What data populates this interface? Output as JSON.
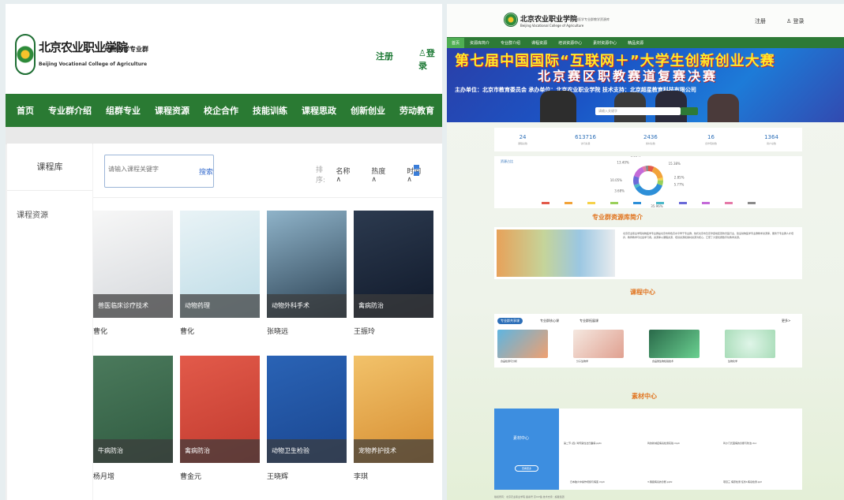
{
  "left": {
    "logo_cn": "北京农业职业学院",
    "logo_en": "Beijing Vocational College of Agriculture",
    "logo_sub": "动物医学专业群",
    "register": "注册",
    "login": "登录",
    "nav": [
      "首页",
      "专业群介绍",
      "组群专业",
      "课程资源",
      "校企合作",
      "技能训练",
      "课程思政",
      "创新创业",
      "劳动教育"
    ],
    "sidebar": {
      "title": "课程库",
      "item": "课程资源"
    },
    "search": {
      "placeholder": "请输入课程关键字",
      "button": "搜索"
    },
    "sort": {
      "label": "排序:",
      "name": "名称",
      "heat": "热度",
      "time": "时间",
      "arrow": "∧"
    },
    "courses": [
      {
        "title": "兽医临床诊疗技术",
        "author": "曹化",
        "colors": [
          "#f7f7f7",
          "#d5d8dc"
        ]
      },
      {
        "title": "动物药理",
        "author": "曹化",
        "colors": [
          "#e9f3f6",
          "#bcdbe6"
        ]
      },
      {
        "title": "动物外科手术",
        "author": "张晓远",
        "colors": [
          "#8fb3c9",
          "#2a4052"
        ]
      },
      {
        "title": "禽病防治",
        "author": "王振玲",
        "colors": [
          "#2c3a4f",
          "#10192a"
        ]
      },
      {
        "title": "牛病防治",
        "author": "杨月增",
        "colors": [
          "#4b7a5c",
          "#2f5a40"
        ]
      },
      {
        "title": "禽病防治",
        "author": "曹金元",
        "colors": [
          "#e25a4a",
          "#c13a2e"
        ]
      },
      {
        "title": "动物卫生检验",
        "author": "王晓辉",
        "colors": [
          "#2a63b5",
          "#1a4690"
        ]
      },
      {
        "title": "宠物养护技术",
        "author": "李琪",
        "colors": [
          "#f2c26a",
          "#d68d31"
        ]
      }
    ]
  },
  "right": {
    "logo": "北京农业职业学院",
    "logo_en": "Beijing Vocational College of Agriculture",
    "logo_sub": "动物医学专业群教学资源库",
    "register": "注册",
    "login": "登录",
    "nav": [
      "首页",
      "资源库简介",
      "专业群介绍",
      "课程资源",
      "培训资源中心",
      "素材资源中心",
      "精品资源"
    ],
    "banner": {
      "line1": "第七届中国国际“互联网＋”大学生创新创业大赛",
      "line2": "北京赛区职教赛道复赛决赛",
      "line3": "主办单位：北京市教育委员会  承办单位：北京农业职业学院  技术支持：北京超星教育科技有限公司",
      "search_placeholder": "请输入关键字"
    },
    "stats": [
      {
        "num": "24",
        "label": "课程总数"
      },
      {
        "num": "613716",
        "label": "访问总量"
      },
      {
        "num": "2436",
        "label": "素材总数"
      },
      {
        "num": "16",
        "label": "合作院校数"
      },
      {
        "num": "1364",
        "label": "用户总数"
      }
    ],
    "chart_title": "资源占比",
    "intro_title": "专业群资源库简介",
    "intro_text": "北京农业职业学院动物医学专业群是北京市特色高水平骨干专业群，依托北京市及京津冀地区畜牧兽医行业，建设动物医学专业群教学资源库，服务于专业群人才培养、教师教学与社会学习者。资源库以课程资源、培训资源和素材资源为核心，汇聚了大量优质数字化教学资源。",
    "course_title": "课程中心",
    "course_tabs": [
      "专业群共享课",
      "专业群核心课",
      "专业群拓展课"
    ],
    "course_cards": [
      "食品检测与分析",
      "分子生物学",
      "食品微生物检验技术",
      "生物化学"
    ],
    "more": "更多>",
    "material_title": "素材中心",
    "material_left": "素材中心",
    "material_btn": "查看更多",
    "material_items": [
      "第二节 (四) 鸡传染性法氏囊病.pptx",
      "鸡的新城疫病毒检测实验.mp4",
      "鸡沙门氏菌病的诊断与防治.doc",
      "日本脑炎中操作视频与病变.mp4",
      "3.猪瘟病毒的诊断.pptx",
      "项目三 病原检测 任务1病毒检测.ppt"
    ],
    "footer": "版权所有：北京农业职业学院            备案号  京ICP备                    技术支持：超星集团"
  },
  "chart_data": {
    "type": "pie",
    "title": "资源占比",
    "slices": [
      {
        "label": "6.43%",
        "value": 6.43,
        "color": "#e25a4a"
      },
      {
        "label": "15.38%",
        "value": 15.38,
        "color": "#f2a33a"
      },
      {
        "label": "2.85%",
        "value": 2.85,
        "color": "#f6d24a"
      },
      {
        "label": "5.77%",
        "value": 5.77,
        "color": "#9ad05a"
      },
      {
        "label": "35.96%",
        "value": 35.96,
        "color": "#2d8fd8"
      },
      {
        "label": "3.68%",
        "value": 3.68,
        "color": "#4bb8c9"
      },
      {
        "label": "10.05%",
        "value": 10.05,
        "color": "#6a6ad8"
      },
      {
        "label": "13.40%",
        "value": 13.4,
        "color": "#c46ad8"
      },
      {
        "label": "3.55%",
        "value": 3.55,
        "color": "#e57aa8"
      },
      {
        "label": "2.93%",
        "value": 2.93,
        "color": "#8b8b8b"
      }
    ]
  }
}
